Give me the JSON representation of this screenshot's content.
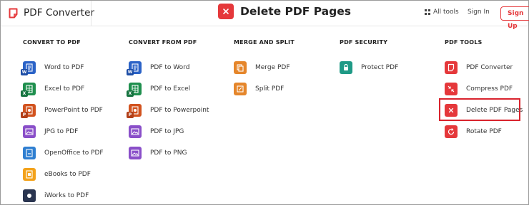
{
  "header": {
    "brand_name": "PDF Converter",
    "page_title": "Delete PDF Pages",
    "all_tools_label": "All tools",
    "sign_in_label": "Sign In",
    "sign_up_label": "Sign Up",
    "accent_color": "#e5383b"
  },
  "menu": {
    "convert_to_pdf": {
      "heading": "CONVERT TO PDF",
      "items": [
        {
          "label": "Word to PDF",
          "icon": "word-icon",
          "color": "#2b63c7"
        },
        {
          "label": "Excel to PDF",
          "icon": "excel-icon",
          "color": "#1f8f4e"
        },
        {
          "label": "PowerPoint to PDF",
          "icon": "powerpoint-icon",
          "color": "#d2531f"
        },
        {
          "label": "JPG to PDF",
          "icon": "image-icon",
          "color": "#8a4fc9"
        },
        {
          "label": "OpenOffice to PDF",
          "icon": "openoffice-icon",
          "color": "#2f7fd1"
        },
        {
          "label": "eBooks to PDF",
          "icon": "ebook-icon",
          "color": "#f3a21b"
        },
        {
          "label": "iWorks to PDF",
          "icon": "iworks-icon",
          "color": "#2a3550"
        }
      ]
    },
    "convert_from_pdf": {
      "heading": "CONVERT FROM PDF",
      "items": [
        {
          "label": "PDF to Word",
          "icon": "word-icon",
          "color": "#2b63c7"
        },
        {
          "label": "PDF to Excel",
          "icon": "excel-icon",
          "color": "#1f8f4e"
        },
        {
          "label": "PDF to Powerpoint",
          "icon": "powerpoint-icon",
          "color": "#d2531f"
        },
        {
          "label": "PDF to JPG",
          "icon": "image-icon",
          "color": "#8a4fc9"
        },
        {
          "label": "PDF to PNG",
          "icon": "image-icon",
          "color": "#8a4fc9"
        }
      ]
    },
    "merge_and_split": {
      "heading": "MERGE AND SPLIT",
      "items": [
        {
          "label": "Merge PDF",
          "icon": "merge-icon",
          "color": "#e5862b"
        },
        {
          "label": "Split PDF",
          "icon": "split-icon",
          "color": "#e5862b"
        }
      ]
    },
    "pdf_security": {
      "heading": "PDF SECURITY",
      "items": [
        {
          "label": "Protect PDF",
          "icon": "lock-icon",
          "color": "#1f9a86"
        }
      ]
    },
    "pdf_tools": {
      "heading": "PDF TOOLS",
      "items": [
        {
          "label": "PDF Converter",
          "icon": "pdf-converter-icon",
          "color": "#e5383b"
        },
        {
          "label": "Compress PDF",
          "icon": "compress-icon",
          "color": "#e5383b"
        },
        {
          "label": "Delete PDF Pages",
          "icon": "delete-icon",
          "color": "#e5383b"
        },
        {
          "label": "Rotate PDF",
          "icon": "rotate-icon",
          "color": "#e5383b"
        }
      ]
    }
  }
}
